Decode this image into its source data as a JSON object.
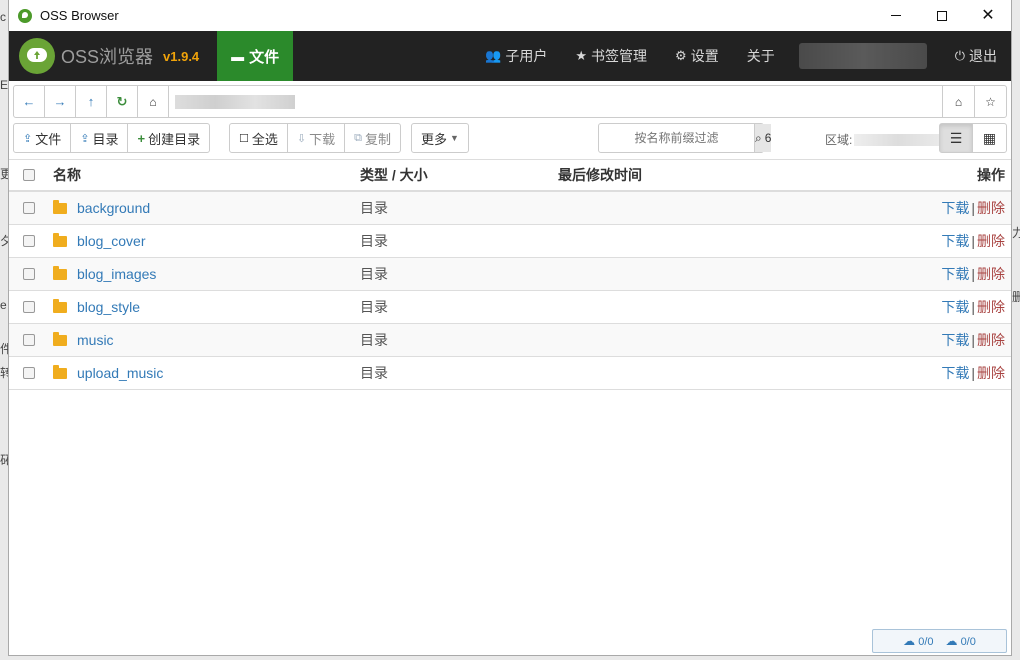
{
  "window": {
    "title": "OSS Browser"
  },
  "navbar": {
    "brand": "OSS浏览器",
    "version": "v1.9.4",
    "file_tab": "文件",
    "items": [
      {
        "label": "子用户",
        "icon": "users-icon"
      },
      {
        "label": "书签管理",
        "icon": "star-icon"
      },
      {
        "label": "设置",
        "icon": "gear-icon"
      },
      {
        "label": "关于"
      }
    ],
    "logout": "退出"
  },
  "toolbar": {
    "upload_file": "文件",
    "upload_dir": "目录",
    "create_dir": "创建目录",
    "select_all": "全选",
    "download": "下载",
    "copy": "复制",
    "more": "更多",
    "filter_placeholder": "按名称前缀过滤",
    "filter_count": "6",
    "region_label": "区域:"
  },
  "table": {
    "headers": {
      "name": "名称",
      "type": "类型 / 大小",
      "modified": "最后修改时间",
      "ops": "操作"
    },
    "rows": [
      {
        "name": "background",
        "type": "目录",
        "download": "下载",
        "sep": "|",
        "delete": "删除"
      },
      {
        "name": "blog_cover",
        "type": "目录",
        "download": "下载",
        "sep": "|",
        "delete": "删除"
      },
      {
        "name": "blog_images",
        "type": "目录",
        "download": "下载",
        "sep": "|",
        "delete": "删除"
      },
      {
        "name": "blog_style",
        "type": "目录",
        "download": "下载",
        "sep": "|",
        "delete": "删除"
      },
      {
        "name": "music",
        "type": "目录",
        "download": "下载",
        "sep": "|",
        "delete": "删除"
      },
      {
        "name": "upload_music",
        "type": "目录",
        "download": "下载",
        "sep": "|",
        "delete": "删除"
      }
    ]
  },
  "status": {
    "upload": "0/0",
    "download": "0/0"
  },
  "colors": {
    "nav_bg": "#222222",
    "active_tab": "#2b8a2b",
    "version": "#f0a30a",
    "link": "#337ab7",
    "danger": "#a94442",
    "folder": "#f0ad1e"
  }
}
